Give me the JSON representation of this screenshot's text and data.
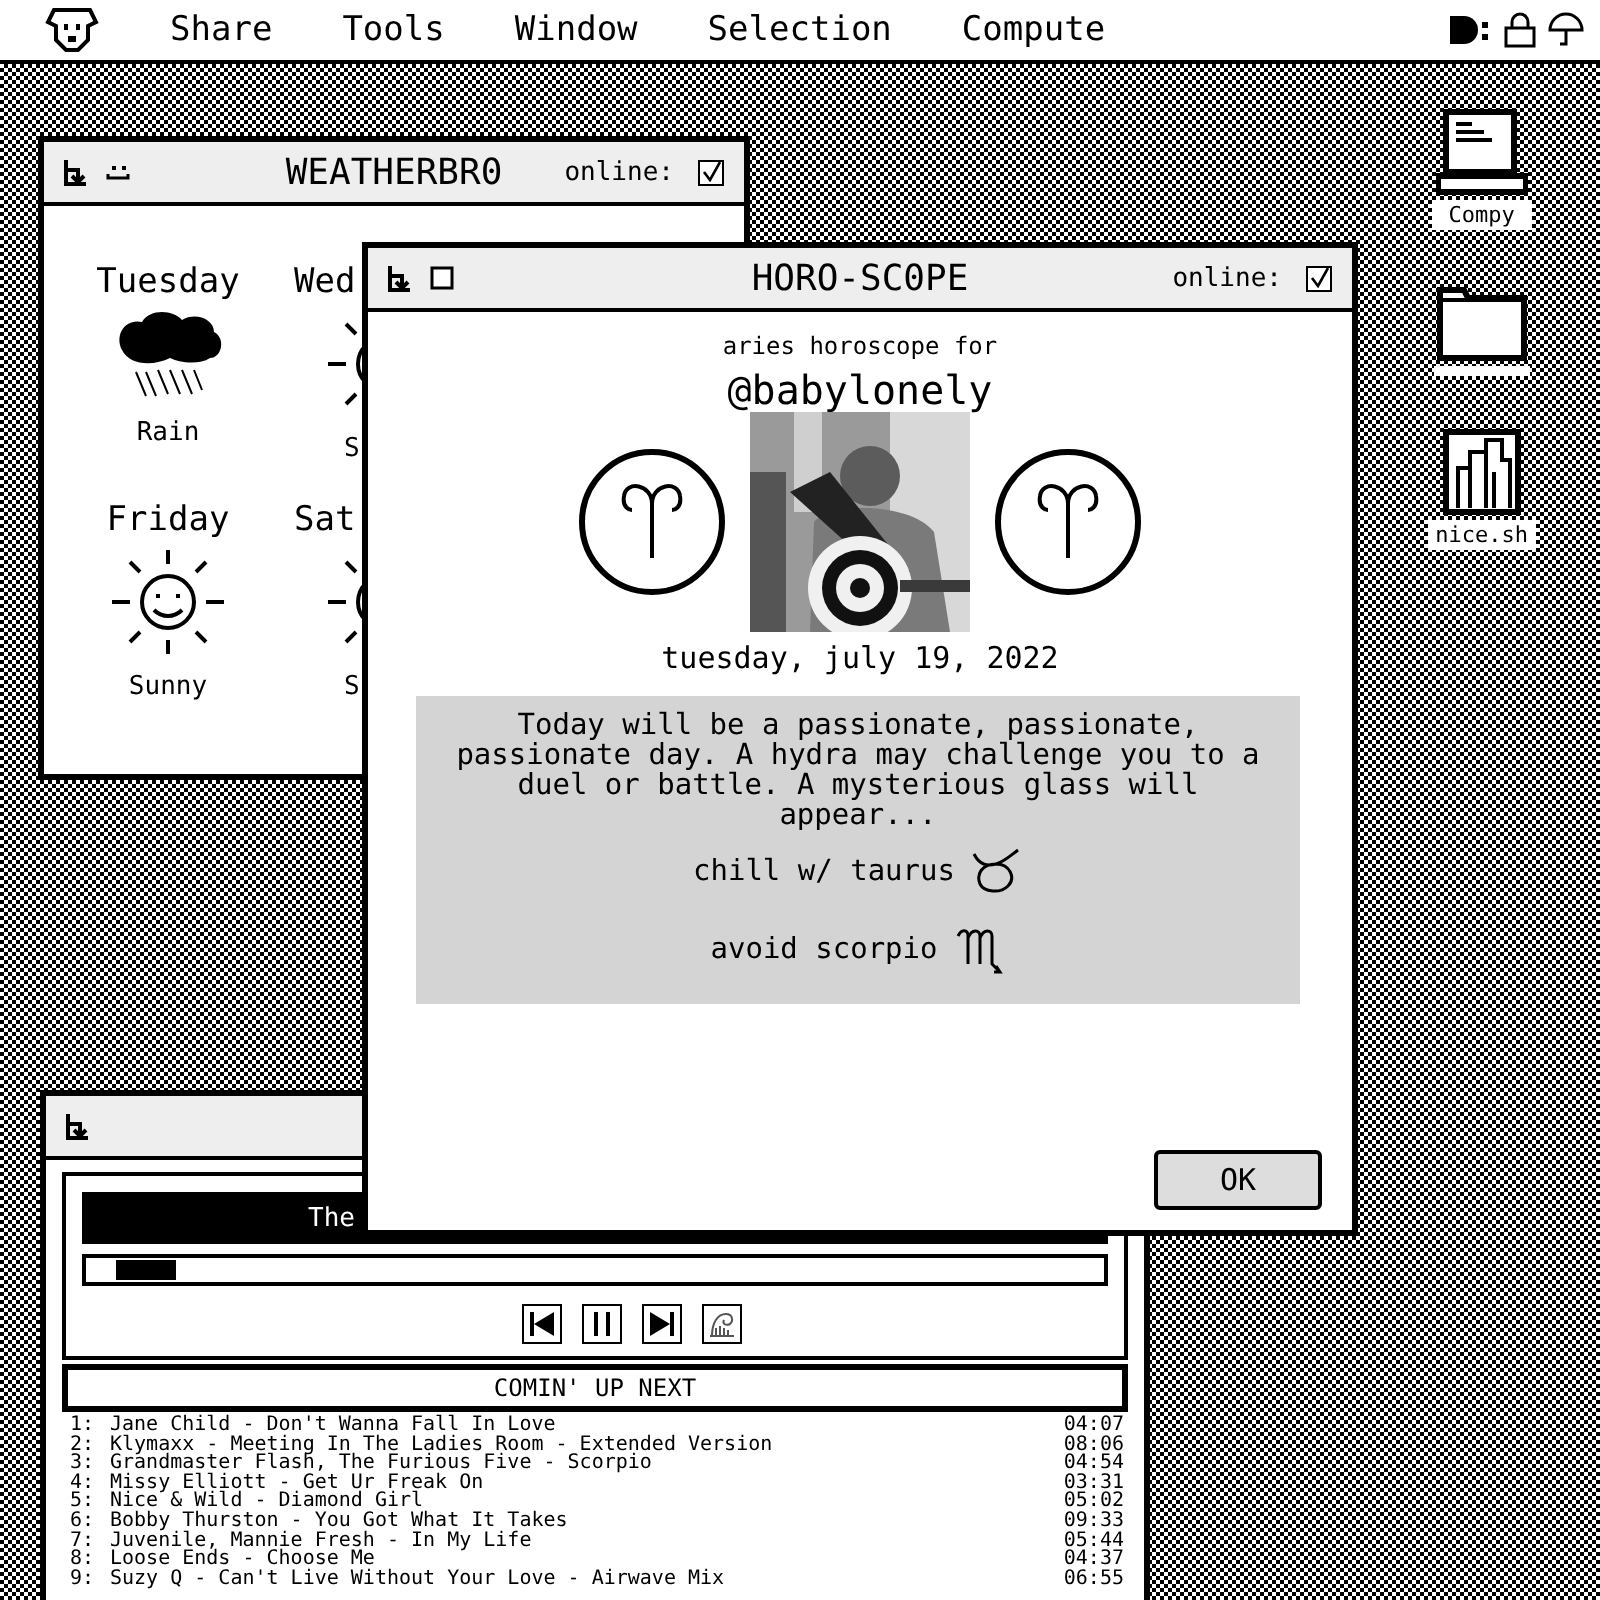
{
  "menu_bar": {
    "items": [
      "Share",
      "Tools",
      "Window",
      "Selection",
      "Compute"
    ]
  },
  "desktop_icons": [
    {
      "kind": "computer",
      "label": "Compy"
    },
    {
      "kind": "folder"
    },
    {
      "kind": "script",
      "label": "nice.sh"
    }
  ],
  "weather_window": {
    "title": "WEATHERBR0",
    "online_label": "online:",
    "online": true,
    "days": [
      {
        "day": "Tuesday",
        "condition": "Rain",
        "kind": "rain"
      },
      {
        "day": "Wed",
        "condition": "S",
        "kind": "sun"
      },
      {
        "day": "Friday",
        "condition": "Sunny",
        "kind": "sun"
      },
      {
        "day": "Sat",
        "condition": "S",
        "kind": "sun"
      }
    ]
  },
  "player_window": {
    "now_playing": "The",
    "level": 0.03,
    "queue_title": "COMIN' UP NEXT",
    "queue": [
      {
        "number": "1:",
        "track": "Jane Child - Don't Wanna Fall In Love",
        "time": "04:07"
      },
      {
        "number": "2:",
        "track": "Klymaxx - Meeting In The Ladies Room - Extended Version",
        "time": "08:06"
      },
      {
        "number": "3:",
        "track": "Grandmaster Flash, The Furious Five - Scorpio",
        "time": "04:54"
      },
      {
        "number": "4:",
        "track": "Missy Elliott - Get Ur Freak On",
        "time": "03:31"
      },
      {
        "number": "5:",
        "track": "Nice & Wild - Diamond Girl",
        "time": "05:02"
      },
      {
        "number": "6:",
        "track": "Bobby Thurston - You Got What It Takes",
        "time": "09:33"
      },
      {
        "number": "7:",
        "track": "Juvenile, Mannie Fresh - In My Life",
        "time": "05:44"
      },
      {
        "number": "8:",
        "track": "Loose Ends - Choose Me",
        "time": "04:37"
      },
      {
        "number": "9:",
        "track": "Suzy Q - Can't Live Without Your Love - Airwave Mix",
        "time": "06:55"
      }
    ]
  },
  "horoscope_window": {
    "title": "HORO-SC0PE",
    "online_label": "online:",
    "online": true,
    "intro": "aries horoscope for",
    "username": "@babylonely",
    "zodiac": {
      "kind": "aries"
    },
    "date": "tuesday, july 19, 2022",
    "reading": "Today will be a passionate, passionate, passionate day. A hydra may challenge you to a duel or battle. A mysterious glass will appear...",
    "advice": [
      {
        "text": "chill w/ taurus",
        "kind": "taurus"
      },
      {
        "text": "avoid scorpio",
        "kind": "scorpio"
      }
    ],
    "button": "OK"
  }
}
